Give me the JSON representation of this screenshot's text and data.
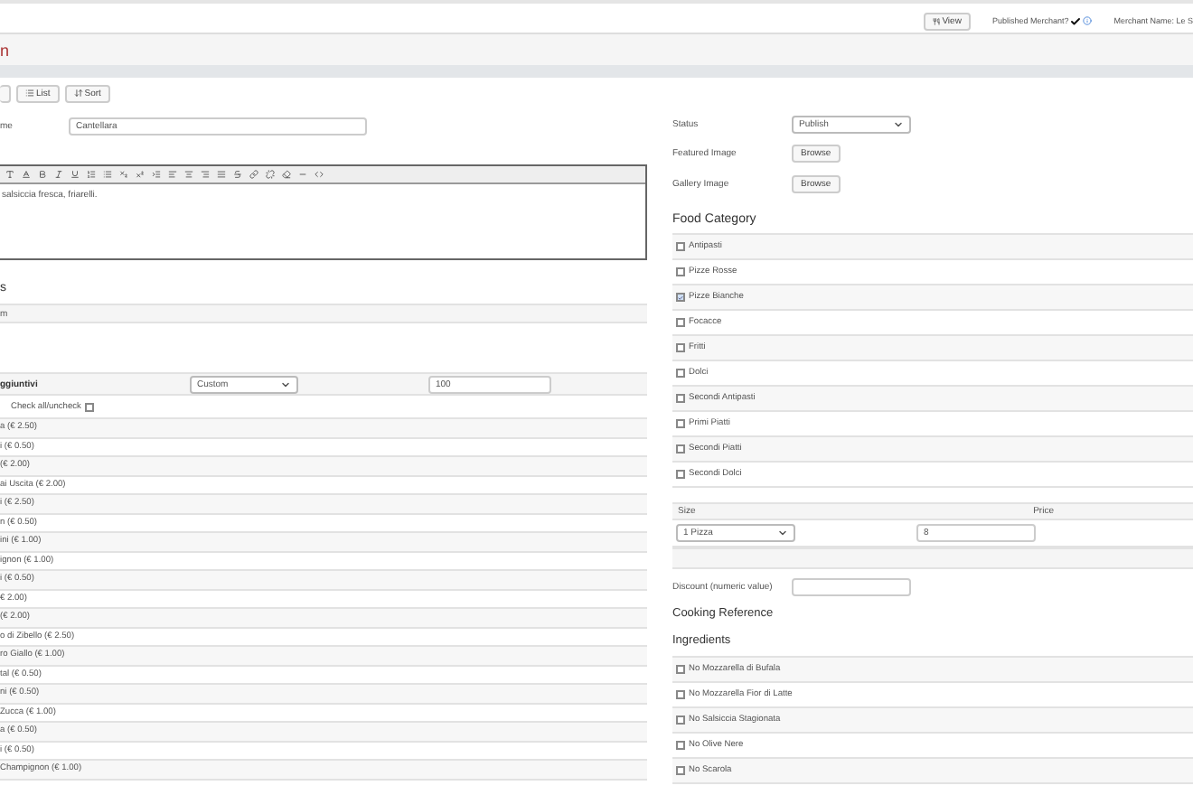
{
  "top_bar": {
    "view_button": "View",
    "published_label": "Published Merchant?",
    "published": true,
    "merchant_name": "Merchant Name: Le S"
  },
  "page_title": "n",
  "toolbar_buttons": [
    "List",
    "Sort"
  ],
  "name_field": {
    "label": "me",
    "value": "Cantellara"
  },
  "editor": {
    "text": "salsiccia fresca, friarelli."
  },
  "section": {
    "heading": "s",
    "row": "m"
  },
  "addons": {
    "label": "ggiuntivi",
    "mode": "Custom",
    "amount": "100",
    "check_all": {
      "label": "Check all/uncheck",
      "checked": false
    },
    "items": [
      "a (€ 2.50)",
      "i (€ 0.50)",
      "(€ 2.00)",
      "ai Uscita (€ 2.00)",
      "i (€ 2.50)",
      "n (€ 0.50)",
      "ini (€ 1.00)",
      "ignon (€ 1.00)",
      "i (€ 0.50)",
      "€ 2.00)",
      "(€ 2.00)",
      "o di Zibello (€ 2.50)",
      "ro Giallo (€ 1.00)",
      "tal (€ 0.50)",
      "ni (€ 0.50)",
      "Zucca (€ 1.00)",
      "a (€ 0.50)",
      "i (€ 0.50)",
      "Champignon (€ 1.00)"
    ]
  },
  "status": {
    "label": "Status",
    "value": "Publish"
  },
  "featured_image": {
    "label": "Featured Image",
    "button": "Browse"
  },
  "gallery_image": {
    "label": "Gallery Image",
    "button": "Browse"
  },
  "food_category": {
    "heading": "Food Category",
    "items": [
      {
        "label": "Antipasti",
        "checked": false
      },
      {
        "label": "Pizze Rosse",
        "checked": false
      },
      {
        "label": "Pizze Bianche",
        "checked": true
      },
      {
        "label": "Focacce",
        "checked": false
      },
      {
        "label": "Fritti",
        "checked": false
      },
      {
        "label": "Dolci",
        "checked": false
      },
      {
        "label": "Secondi Antipasti",
        "checked": false
      },
      {
        "label": "Primi Piatti",
        "checked": false
      },
      {
        "label": "Secondi Piatti",
        "checked": false
      },
      {
        "label": "Secondi Dolci",
        "checked": false
      }
    ]
  },
  "sizes": {
    "columns": [
      "Size",
      "Price"
    ],
    "rows": [
      {
        "size": "1 Pizza",
        "price": "8"
      }
    ]
  },
  "discount": {
    "label": "Discount (numeric value)"
  },
  "cooking_reference": {
    "heading": "Cooking Reference"
  },
  "ingredients": {
    "heading": "Ingredients",
    "items": [
      {
        "label": "No Mozzarella di Bufala",
        "checked": false
      },
      {
        "label": "No Mozzarella Fior di Latte",
        "checked": false
      },
      {
        "label": "No Salsiccia Stagionata",
        "checked": false
      },
      {
        "label": "No Olive Nere",
        "checked": false
      },
      {
        "label": "No Scarola",
        "checked": false
      }
    ]
  }
}
